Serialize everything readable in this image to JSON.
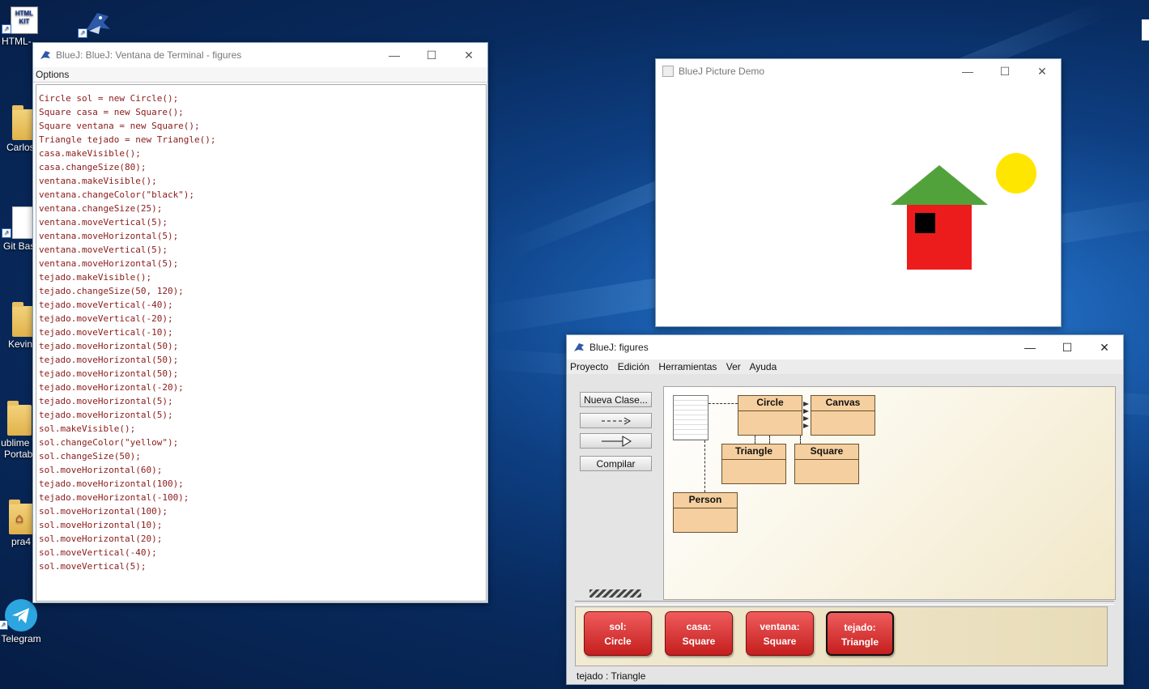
{
  "desktop": {
    "icons": [
      {
        "label": "HTML-",
        "icon": "html-kit-icon"
      },
      {
        "label": "",
        "icon": "bluej-icon"
      },
      {
        "label": "Carlos",
        "icon": "folder-icon"
      },
      {
        "label": "Git Bas",
        "icon": "git-bash-icon"
      },
      {
        "label": "Kevin",
        "icon": "folder-icon"
      },
      {
        "label": "ublime T\nPortabl",
        "icon": "folder-icon"
      },
      {
        "label": "pra4",
        "icon": "pdf-icon"
      },
      {
        "label": "Telegram",
        "icon": "telegram-icon"
      }
    ],
    "html_kit_text": "HTML KIT"
  },
  "terminal": {
    "title": "BlueJ: BlueJ:  Ventana de Terminal - figures",
    "menu": "Options",
    "lines": [
      "Circle sol = new Circle();",
      "Square casa = new Square();",
      "Square ventana = new Square();",
      "Triangle tejado = new Triangle();",
      "casa.makeVisible();",
      "casa.changeSize(80);",
      "ventana.makeVisible();",
      "ventana.changeColor(\"black\");",
      "ventana.changeSize(25);",
      "ventana.moveVertical(5);",
      "ventana.moveHorizontal(5);",
      "ventana.moveVertical(5);",
      "ventana.moveHorizontal(5);",
      "tejado.makeVisible();",
      "tejado.changeSize(50, 120);",
      "tejado.moveVertical(-40);",
      "tejado.moveVertical(-20);",
      "tejado.moveVertical(-10);",
      "tejado.moveHorizontal(50);",
      "tejado.moveHorizontal(50);",
      "tejado.moveHorizontal(50);",
      "tejado.moveHorizontal(-20);",
      "tejado.moveHorizontal(5);",
      "tejado.moveHorizontal(5);",
      "sol.makeVisible();",
      "sol.changeColor(\"yellow\");",
      "sol.changeSize(50);",
      "sol.moveHorizontal(60);",
      "tejado.moveHorizontal(100);",
      "tejado.moveHorizontal(-100);",
      "sol.moveHorizontal(100);",
      "sol.moveHorizontal(10);",
      "sol.moveHorizontal(20);",
      "sol.moveVertical(-40);",
      "sol.moveVertical(5);"
    ]
  },
  "picture_demo": {
    "title": "BlueJ Picture Demo",
    "colors": {
      "house": "#ed1c1c",
      "window": "#000000",
      "roof": "#52a23c",
      "sun": "#ffe600"
    }
  },
  "bluej": {
    "title": "BlueJ:  figures",
    "menu": [
      "Proyecto",
      "Edición",
      "Herramientas",
      "Ver",
      "Ayuda"
    ],
    "buttons": {
      "new_class": "Nueva Clase...",
      "compile": "Compilar"
    },
    "classes": [
      "Circle",
      "Canvas",
      "Triangle",
      "Square",
      "Person"
    ],
    "objects": [
      {
        "name": "sol:",
        "type": "Circle"
      },
      {
        "name": "casa:",
        "type": "Square"
      },
      {
        "name": "ventana:",
        "type": "Square"
      },
      {
        "name": "tejado:",
        "type": "Triangle"
      }
    ],
    "status": "tejado : Triangle"
  }
}
